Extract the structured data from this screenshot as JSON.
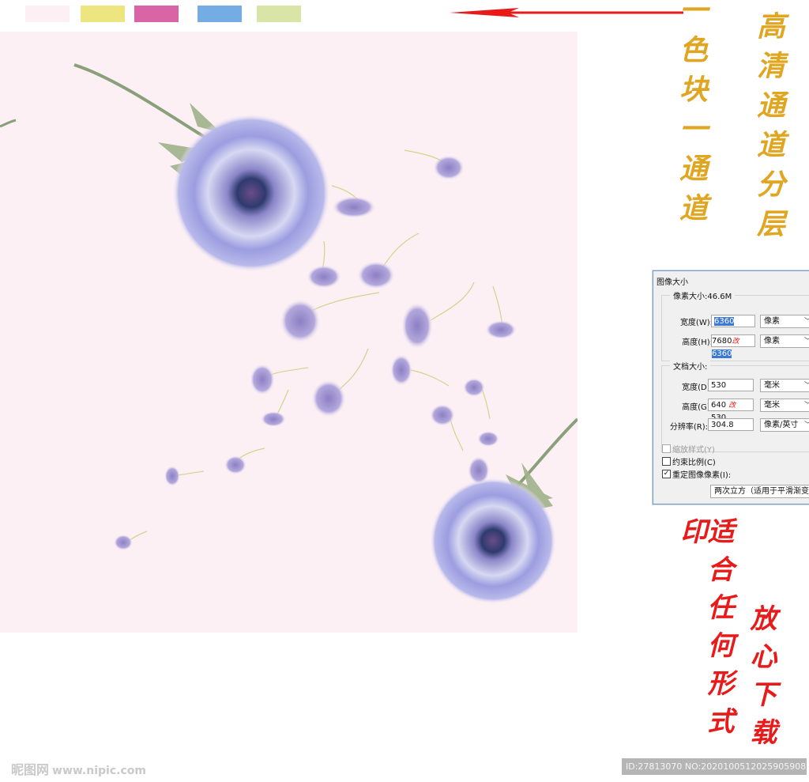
{
  "swatches": [
    "#fcf0f5",
    "#ede57f",
    "#d965a6",
    "#74ade3",
    "#d8e5a6"
  ],
  "arrow": {
    "color": "#e81a1a",
    "direction": "left"
  },
  "vertical_texts": [
    {
      "text": "一色块一通道",
      "color": "#e0a521"
    },
    {
      "text": "高清通道分层",
      "color": "#e0a521"
    },
    {
      "text": "适合任何形式印",
      "color": "#e81a1a"
    },
    {
      "text": "放心下载",
      "color": "#e81a1a"
    }
  ],
  "artwork": {
    "background": "#fcf0f5",
    "subject": "watercolor dandelions with floating seeds"
  },
  "dialog": {
    "title": "图像大小",
    "pixel_size_label": "像素大小:46.6M",
    "width_label": "宽度(W):",
    "width_value": "6360",
    "width_unit": "像素",
    "height_label": "高度(H):",
    "height_value_old": "7680",
    "height_change_mark": "改",
    "height_value_new": "6360",
    "height_unit": "像素",
    "doc_size_label": "文档大小:",
    "doc_width_label": "宽度(D):",
    "doc_width_value": "530",
    "doc_width_unit": "毫米",
    "doc_height_label": "高度(G):",
    "doc_height_value_old": "640",
    "doc_height_change_mark": "改",
    "doc_height_value_new": "530",
    "doc_height_unit": "毫米",
    "resolution_label": "分辨率(R):",
    "resolution_value": "304.8",
    "resolution_unit": "像素/英寸",
    "scale_styles_label": "缩放样式(Y)",
    "constrain_label": "约束比例(C)",
    "resample_label": "重定图像像素(I):",
    "resample_method": "两次立方（适用于平滑渐变）",
    "constrain_checked": false,
    "resample_checked": true,
    "scale_styles_enabled": false
  },
  "watermark": {
    "brand": "昵图网",
    "url": "www.nipic.com"
  },
  "id_bar": "ID:27813070 NO:20201005120259059086"
}
